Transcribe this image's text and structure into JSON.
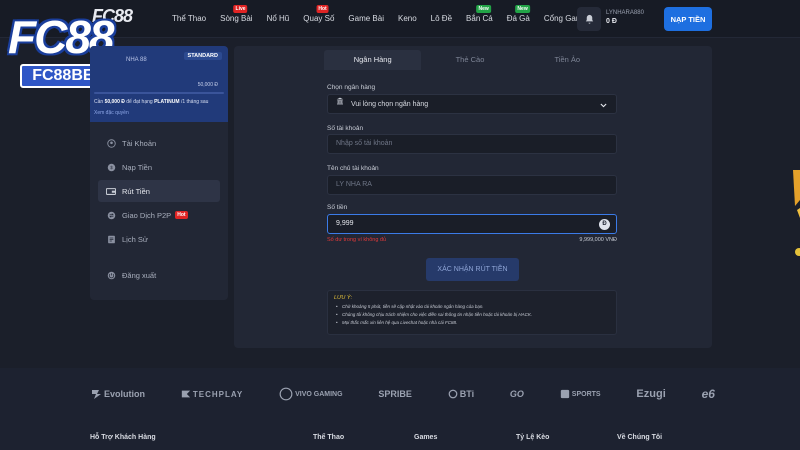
{
  "header": {
    "brand_small": "FC88",
    "nav": [
      {
        "label": "Thể Thao",
        "badge": ""
      },
      {
        "label": "Sòng Bài",
        "badge": "Live"
      },
      {
        "label": "Nổ Hũ",
        "badge": ""
      },
      {
        "label": "Quay Số",
        "badge": "Hot"
      },
      {
        "label": "Game Bài",
        "badge": ""
      },
      {
        "label": "Keno",
        "badge": ""
      },
      {
        "label": "Lô Đề",
        "badge": ""
      },
      {
        "label": "Bắn Cá",
        "badge": "New"
      },
      {
        "label": "Đá Gà",
        "badge": "New"
      },
      {
        "label": "Cổng Game",
        "badge": ""
      }
    ],
    "username": "LYNHARA880",
    "balance": "0 Đ",
    "deposit_label": "NẠP TIỀN"
  },
  "logo": {
    "main": "FC88",
    "sub": "FC88BETX.COM"
  },
  "sidebar": {
    "vip": {
      "tier": "STANDARD",
      "rank": "NHA\n88",
      "points": "50,000 Đ",
      "progress": 0.0,
      "note_prefix": "Cần",
      "note_amount": "50,000 Đ",
      "note_mid": "để đạt hạng",
      "note_tier": "PLATINUM",
      "note_suffix": "/1 tháng sau",
      "link": "Xem đặc quyền"
    },
    "items": [
      {
        "label": "Tài Khoản",
        "icon": "user-icon",
        "active": false
      },
      {
        "label": "Nạp Tiền",
        "icon": "deposit-icon",
        "active": false
      },
      {
        "label": "Rút Tiền",
        "icon": "withdraw-icon",
        "active": true
      },
      {
        "label": "Giao Dịch P2P",
        "icon": "p2p-icon",
        "active": false,
        "tag": "Hot"
      },
      {
        "label": "Lịch Sử",
        "icon": "history-icon",
        "active": false
      }
    ],
    "logout": "Đăng xuất"
  },
  "main": {
    "tabs": [
      {
        "label": "Ngân Hàng",
        "active": true
      },
      {
        "label": "Thẻ Cào",
        "active": false
      },
      {
        "label": "Tiền Ảo",
        "active": false
      }
    ],
    "bank_label": "Chọn ngân hàng",
    "bank_value": "Vui lòng chọn ngân hàng",
    "account_label": "Số tài khoản",
    "account_placeholder": "Nhập số tài khoản",
    "holder_label": "Tên chủ tài khoản",
    "holder_value": "LY NHA RA",
    "amount_label": "Số tiền",
    "amount_value": "9,999",
    "amount_currency_symbol": "Đ",
    "error_text": "Số dư trong ví không đủ",
    "converted": "9,999,000 VNĐ",
    "confirm_label": "XÁC NHẬN RÚT TIỀN",
    "note_title": "LƯU Ý:",
    "notes": [
      "Chờ khoảng 5 phút, tiền sẽ cập nhật vào tài khoản ngân hàng của bạn.",
      "Chúng tôi không chịu trách nhiệm cho việc điền sai thông tin nhận tiền hoặc tài khoản bị HACK.",
      "Mọi thắc mắc xin liên hệ qua Livechat hoặc nhà cái FC88."
    ]
  },
  "footer": {
    "partners": [
      "Evolution",
      "TECHPLAY",
      "VIVO GAMING",
      "SPRIBE",
      "BTi",
      "GO",
      "SPORTS",
      "Ezugi",
      "e6"
    ],
    "columns": [
      "Hỗ Trợ Khách Hàng",
      "Thể Thao",
      "Games",
      "Tỷ Lệ Kèo",
      "Về Chúng Tôi"
    ]
  },
  "colors": {
    "accent": "#1e6fe0",
    "error": "#e23a3a",
    "note_title": "#e5c23a",
    "hot": "#e02424",
    "new": "#22a447"
  }
}
